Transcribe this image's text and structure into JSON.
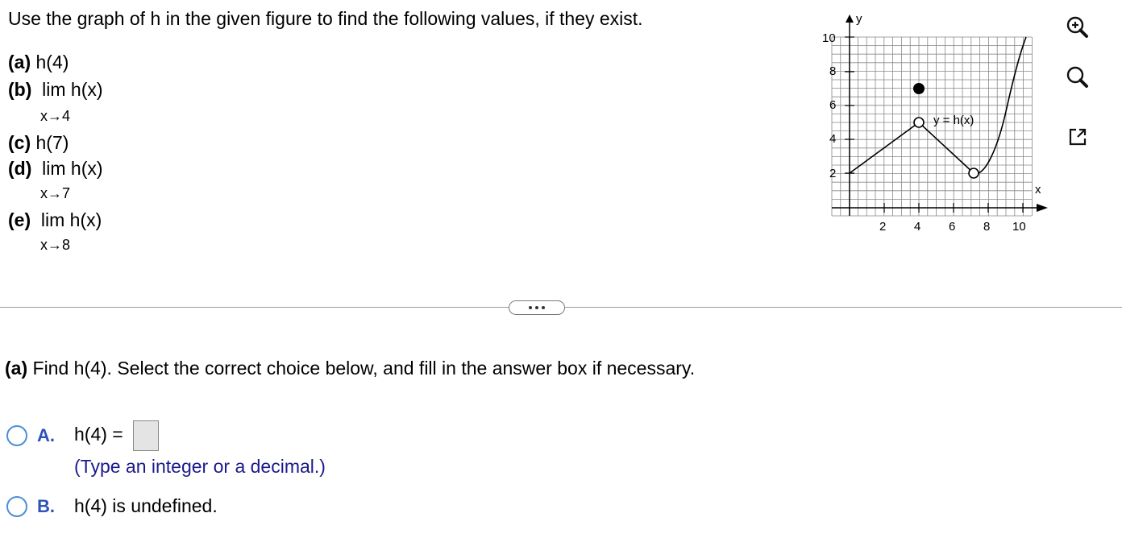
{
  "problem": {
    "intro": "Use the graph of h in the given figure to find the following values, if they exist.",
    "parts": [
      {
        "letter": "(a)",
        "text": "h(4)",
        "sub": ""
      },
      {
        "letter": "(b)",
        "text": "lim h(x)",
        "sub": "x→4"
      },
      {
        "letter": "(c)",
        "text": "h(7)",
        "sub": ""
      },
      {
        "letter": "(d)",
        "text": "lim h(x)",
        "sub": "x→7"
      },
      {
        "letter": "(e)",
        "text": "lim h(x)",
        "sub": "x→8"
      }
    ]
  },
  "graph": {
    "y_axis_label": "y",
    "x_axis_label": "x",
    "curve_label": "y = h(x)",
    "x_ticks": [
      "2",
      "4",
      "6",
      "8",
      "10"
    ],
    "y_ticks": [
      "2",
      "4",
      "6",
      "8",
      "10"
    ]
  },
  "toolbar": {
    "zoom_in": "zoom-in-icon",
    "zoom_out": "zoom-out-icon",
    "popout": "popout-icon"
  },
  "question": {
    "label": "(a)",
    "text": "Find h(4). Select the correct choice below, and fill in the answer box if necessary."
  },
  "choices": [
    {
      "letter": "A.",
      "text": "h(4) =",
      "hint": "(Type an integer or a decimal.)"
    },
    {
      "letter": "B.",
      "text": "h(4) is undefined."
    }
  ],
  "colors": {
    "choice_letter": "#2e52b8",
    "radio_border": "#4a8fd6",
    "hint": "#1a1a8c"
  }
}
